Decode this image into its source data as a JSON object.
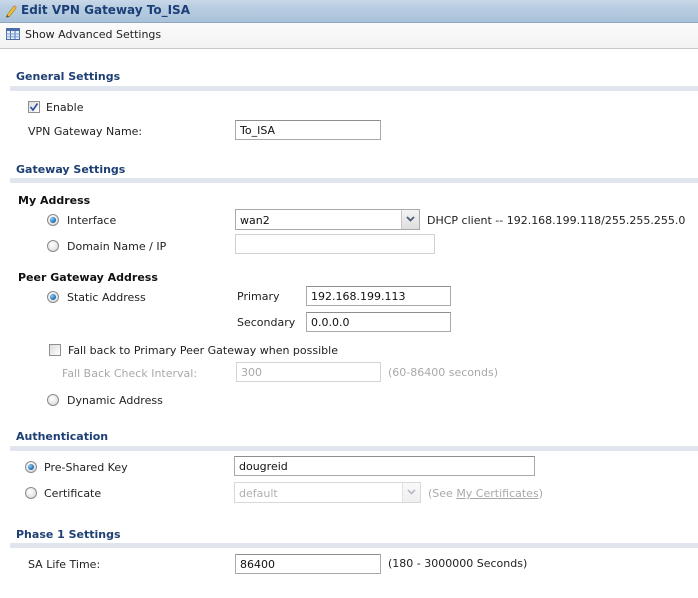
{
  "window": {
    "title": "Edit VPN Gateway To_ISA",
    "title_icon": "pencil-icon"
  },
  "toolbar": {
    "advanced_label": "Show Advanced Settings",
    "advanced_icon": "table-icon"
  },
  "general": {
    "section_title": "General Settings",
    "enable_label": "Enable",
    "enable_checked": true,
    "name_label": "VPN Gateway Name:",
    "name_value": "To_ISA"
  },
  "gateway": {
    "section_title": "Gateway Settings",
    "my_address": {
      "heading": "My Address",
      "interface_label": "Interface",
      "interface_selected": true,
      "interface_value": "wan2",
      "interface_info": "DHCP client -- 192.168.199.118/255.255.255.0",
      "domain_label": "Domain Name / IP",
      "domain_selected": false,
      "domain_value": ""
    },
    "peer": {
      "heading": "Peer Gateway Address",
      "static_label": "Static Address",
      "static_selected": true,
      "primary_label": "Primary",
      "primary_value": "192.168.199.113",
      "secondary_label": "Secondary",
      "secondary_value": "0.0.0.0",
      "fallback_label": "Fall back to Primary Peer Gateway when possible",
      "fallback_checked": false,
      "interval_label": "Fall Back Check Interval:",
      "interval_value": "300",
      "interval_hint": "(60-86400 seconds)",
      "dynamic_label": "Dynamic Address",
      "dynamic_selected": false
    }
  },
  "auth": {
    "section_title": "Authentication",
    "psk_label": "Pre-Shared Key",
    "psk_selected": true,
    "psk_value": "dougreid",
    "cert_label": "Certificate",
    "cert_selected": false,
    "cert_value": "default",
    "cert_hint_prefix": "(See ",
    "cert_hint_link": "My Certificates",
    "cert_hint_suffix": ")"
  },
  "phase1": {
    "section_title": "Phase 1 Settings",
    "sa_label": "SA Life Time:",
    "sa_value": "86400",
    "sa_hint": "(180 - 3000000 Seconds)"
  },
  "colors": {
    "section_title": "#1e3f73",
    "window_title": "#1c3f78",
    "section_bar": "#e1e5ee",
    "disabled_text": "#a9a9a9"
  }
}
